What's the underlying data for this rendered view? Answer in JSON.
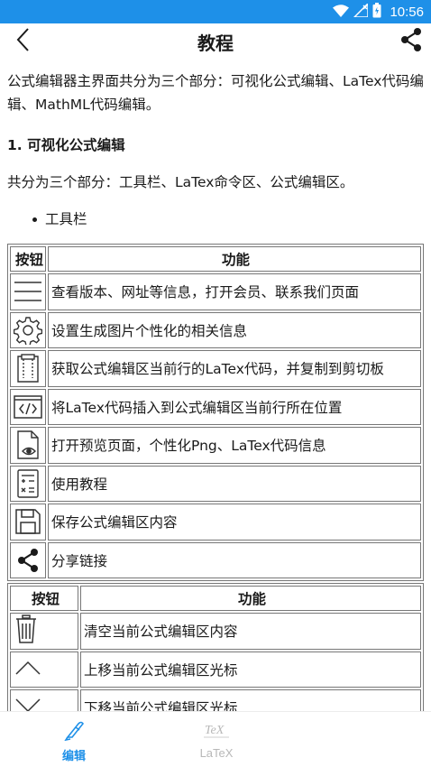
{
  "status_bar": {
    "time": "10:56",
    "bg_color": "#1e90e8",
    "icons": [
      "wifi-icon",
      "signal-icon",
      "battery-icon"
    ]
  },
  "app_bar": {
    "title": "教程",
    "back_icon": "chevron-left-icon",
    "share_icon": "share-icon"
  },
  "intro": "公式编辑器主界面共分为三个部分：可视化公式编辑、LaTex代码编辑、MathML代码编辑。",
  "section1": {
    "heading": "1. 可视化公式编辑",
    "desc": "共分为三个部分：工具栏、LaTex命令区、公式编辑区。",
    "bullet": "工具栏"
  },
  "table1": {
    "headers": [
      "按钮",
      "功能"
    ],
    "rows": [
      {
        "icon": "menu-icon",
        "text": "查看版本、网址等信息，打开会员、联系我们页面"
      },
      {
        "icon": "gear-icon",
        "text": "设置生成图片个性化的相关信息"
      },
      {
        "icon": "clipboard-icon",
        "text": "获取公式编辑区当前行的LaTex代码，并复制到剪切板"
      },
      {
        "icon": "code-icon",
        "text": "将LaTex代码插入到公式编辑区当前行所在位置"
      },
      {
        "icon": "preview-icon",
        "text": "打开预览页面，个性化Png、LaTex代码信息"
      },
      {
        "icon": "tutorial-icon",
        "text": "使用教程"
      },
      {
        "icon": "save-icon",
        "text": "保存公式编辑区内容"
      },
      {
        "icon": "share-icon",
        "text": "分享链接"
      }
    ]
  },
  "table2": {
    "headers": [
      "按钮",
      "功能"
    ],
    "rows": [
      {
        "icon": "trash-icon",
        "text": "清空当前公式编辑区内容"
      },
      {
        "icon": "chevron-up-icon",
        "text": "上移当前公式编辑区光标"
      },
      {
        "icon": "chevron-down-icon",
        "text": "下移当前公式编辑区光标"
      }
    ]
  },
  "bottom_nav": {
    "items": [
      {
        "label": "编辑",
        "icon": "pen-icon",
        "active": true,
        "color": "#1e90e8"
      },
      {
        "label": "LaTeX",
        "icon": "tex-icon",
        "icon_text": "TeX",
        "active": false,
        "color": "#b8b8b8"
      }
    ]
  }
}
